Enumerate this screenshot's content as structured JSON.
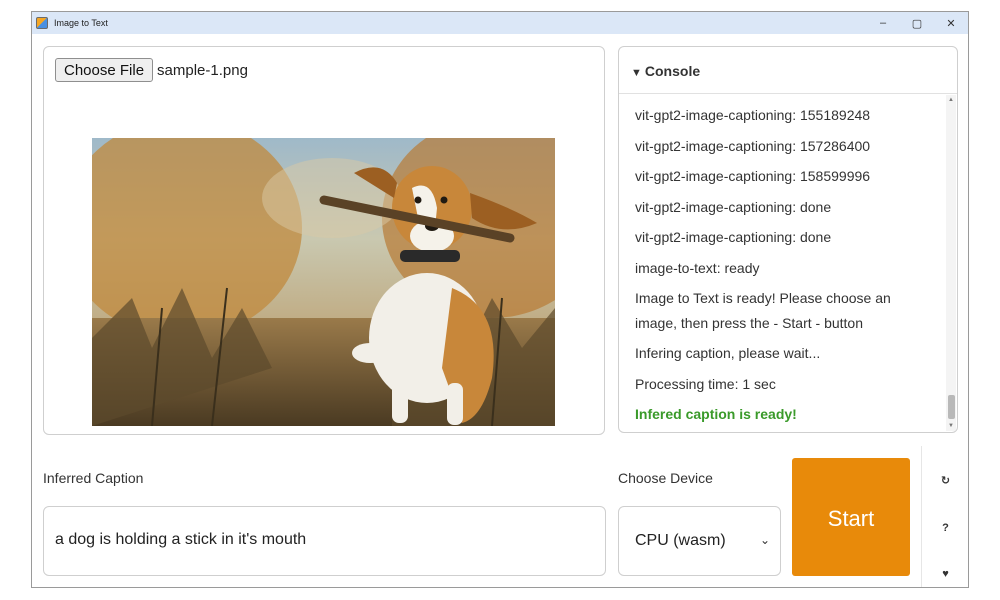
{
  "window": {
    "title": "Image to Text",
    "controls": {
      "minimize": "–",
      "maximize": "▢",
      "close": "✕"
    }
  },
  "file_input": {
    "button_label": "Choose File",
    "file_name": "sample-1.png"
  },
  "preview": {
    "subject": "dog running with stick"
  },
  "console": {
    "title": "Console",
    "caret": "▼",
    "lines": [
      "vit-gpt2-image-captioning: 155189248",
      "vit-gpt2-image-captioning: 157286400",
      "vit-gpt2-image-captioning: 158599996",
      "vit-gpt2-image-captioning: done",
      "vit-gpt2-image-captioning: done",
      "image-to-text: ready",
      "Image to Text is ready! Please choose an image, then press the - Start - button",
      "Infering caption, please wait...",
      "Processing time: 1 sec",
      "Infered caption is ready!"
    ],
    "success_color": "#3a9a2a"
  },
  "caption": {
    "label": "Inferred Caption",
    "value": "a dog is holding a stick in it's mouth"
  },
  "device": {
    "label": "Choose Device",
    "selected": "CPU (wasm)"
  },
  "start": {
    "label": "Start",
    "color": "#e88a0a"
  },
  "side_tools": {
    "refresh": "↻",
    "help": "?",
    "heart": "♥"
  }
}
